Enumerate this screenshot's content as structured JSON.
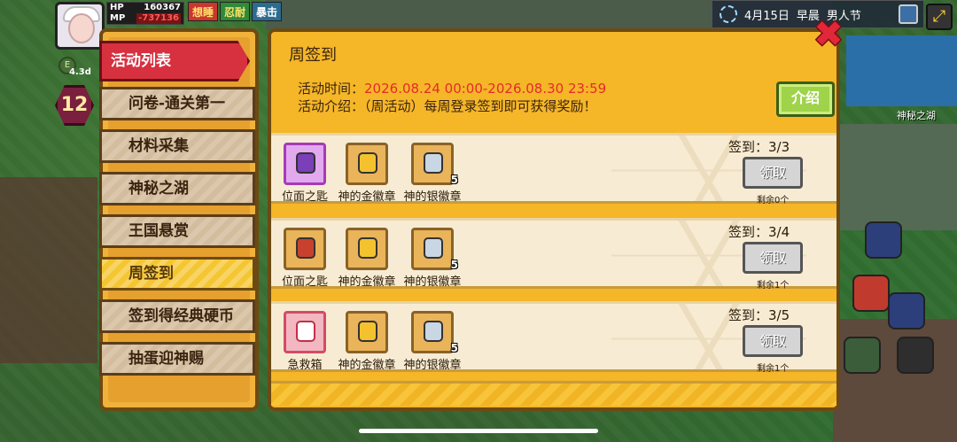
{
  "hud": {
    "hp_label": "HP",
    "hp_value": "160367",
    "mp_label": "MP",
    "mp_value": "-737136",
    "tags": [
      "想睡",
      "忍耐",
      "暴击"
    ],
    "level": "12",
    "days": "4.3d",
    "date": "4月15日",
    "time_of_day": "早晨",
    "festival": "男人节",
    "location_label": "神秘之湖"
  },
  "sidebar": {
    "header": "活动列表",
    "items": [
      {
        "label": "问卷-通关第一"
      },
      {
        "label": "材料采集"
      },
      {
        "label": "神秘之湖"
      },
      {
        "label": "王国悬赏"
      },
      {
        "label": "周签到"
      },
      {
        "label": "签到得经典硬币"
      },
      {
        "label": "抽蛋迎神赐"
      }
    ]
  },
  "main": {
    "title": "周签到",
    "time_label": "活动时间：",
    "time_value": "2026.08.24 00:00-2026.08.30 23:59",
    "intro_label": "活动介绍：",
    "intro_value": "（周活动）每周登录签到即可获得奖励！",
    "intro_button": "介绍",
    "close_icon": "close-icon",
    "colors": {
      "accent": "#f5b628",
      "time": "#e62b2b",
      "intro_btn": "#9fd34a"
    }
  },
  "rewards": [
    {
      "signin": "签到：3/3",
      "claim": "领取",
      "remaining": "剩余0个",
      "items": [
        {
          "name": "位面之匙",
          "count": "",
          "color": "#7b3fb8",
          "frame": "purple"
        },
        {
          "name": "神的金徽章",
          "count": "",
          "color": "#f4c22e",
          "frame": "gold"
        },
        {
          "name": "神的银徽章",
          "count": "5",
          "color": "#c9d6e3",
          "frame": "gold"
        }
      ]
    },
    {
      "signin": "签到：3/4",
      "claim": "领取",
      "remaining": "剩余1个",
      "items": [
        {
          "name": "位面之匙",
          "count": "",
          "color": "#c8412e",
          "frame": "gold"
        },
        {
          "name": "神的金徽章",
          "count": "",
          "color": "#f4c22e",
          "frame": "gold"
        },
        {
          "name": "神的银徽章",
          "count": "5",
          "color": "#c9d6e3",
          "frame": "gold"
        }
      ]
    },
    {
      "signin": "签到：3/5",
      "claim": "领取",
      "remaining": "剩余1个",
      "items": [
        {
          "name": "急救箱",
          "count": "",
          "color": "#ffffff",
          "frame": "pink"
        },
        {
          "name": "神的金徽章",
          "count": "",
          "color": "#f4c22e",
          "frame": "gold"
        },
        {
          "name": "神的银徽章",
          "count": "5",
          "color": "#c9d6e3",
          "frame": "gold"
        }
      ]
    }
  ]
}
